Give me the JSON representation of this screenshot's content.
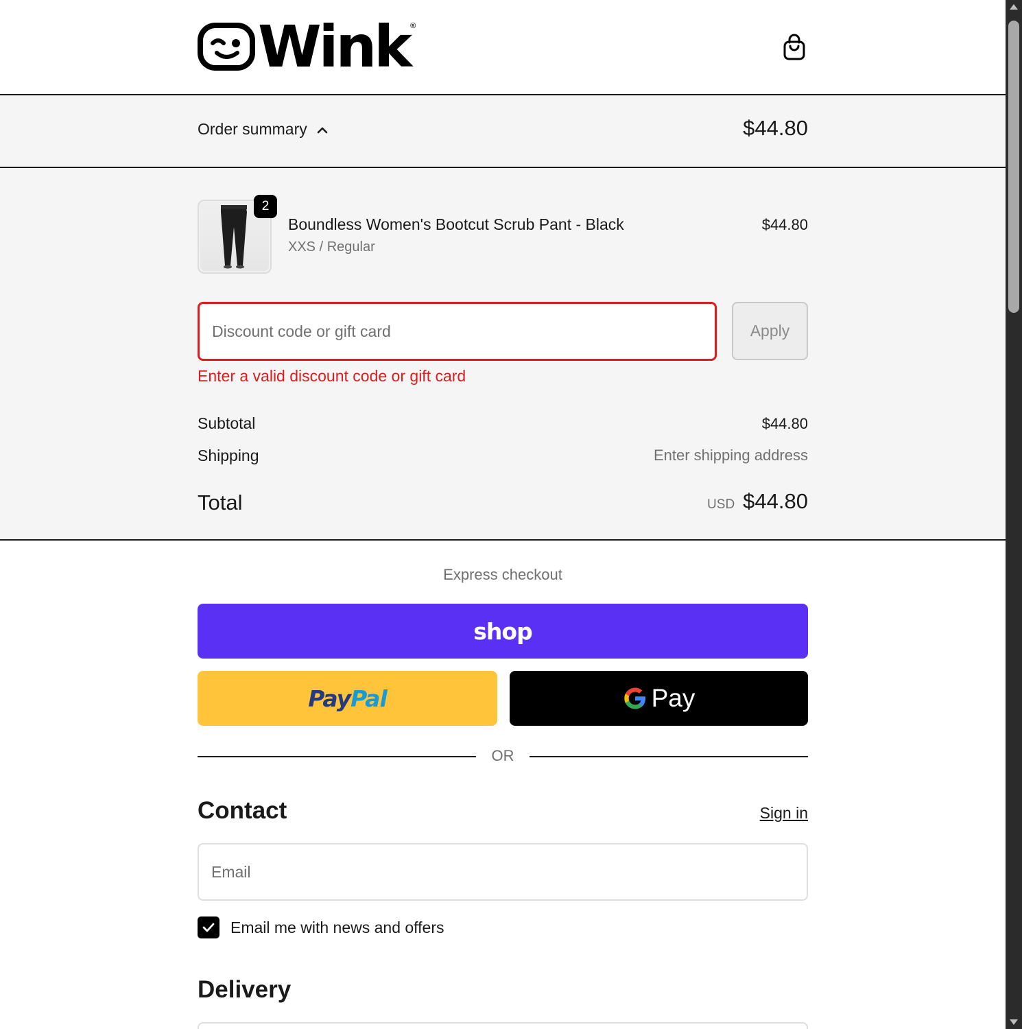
{
  "brand": {
    "name": "Wink",
    "registered": "®"
  },
  "colors": {
    "error": "#dd1d1d",
    "shop_pay": "#5a31f4",
    "paypal_bg": "#ffc439",
    "paypal_dark": "#253b80",
    "paypal_light": "#179bd7",
    "gpay_bg": "#000000",
    "summary_bg": "#f5f5f5"
  },
  "header": {
    "cart_icon": "shopping-bag-icon"
  },
  "summary_bar": {
    "toggle_label": "Order summary",
    "toggle_icon": "chevron-up-icon",
    "price": "$44.80"
  },
  "product": {
    "quantity": "2",
    "name": "Boundless Women's Bootcut Scrub Pant - Black",
    "variant": "XXS / Regular",
    "price": "$44.80"
  },
  "discount": {
    "placeholder": "Discount code or gift card",
    "apply_label": "Apply",
    "error": "Enter a valid discount code or gift card"
  },
  "totals": {
    "subtotal_label": "Subtotal",
    "subtotal_value": "$44.80",
    "shipping_label": "Shipping",
    "shipping_value": "Enter shipping address",
    "total_label": "Total",
    "currency": "USD",
    "total_value": "$44.80"
  },
  "express": {
    "title": "Express checkout",
    "shop_label": "shop",
    "paypal_pay": "Pay",
    "paypal_pal": "Pal",
    "gpay_label": "Pay",
    "or_label": "OR"
  },
  "contact": {
    "title": "Contact",
    "signin_label": "Sign in",
    "email_placeholder": "Email",
    "newsletter_label": "Email me with news and offers",
    "newsletter_checked": true
  },
  "delivery": {
    "title": "Delivery"
  }
}
